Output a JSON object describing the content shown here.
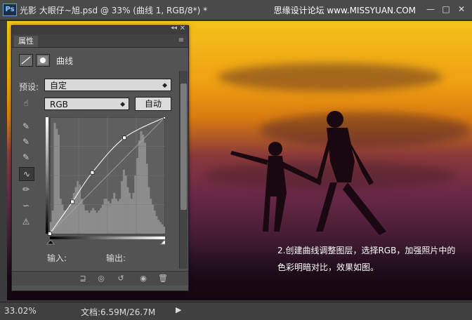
{
  "window": {
    "app_icon": "Ps",
    "title": "光影   大眼仔~旭.psd @ 33% (曲线 1, RGB/8*) *",
    "watermark": "思缘设计论坛 www.MISSYUAN.COM",
    "minimize": "—",
    "maximize": "□",
    "close": "✕"
  },
  "panel": {
    "tab_label": "属性",
    "header_title": "曲线",
    "preset_label": "预设:",
    "preset_value": "自定",
    "channel_value": "RGB",
    "auto_button": "自动",
    "input_label": "输入:",
    "output_label": "输出:"
  },
  "tools": [
    "eyedropper-black-icon",
    "eyedropper-gray-icon",
    "eyedropper-white-icon",
    "curve-point-icon",
    "pencil-icon",
    "smooth-icon",
    "clipping-warning-icon"
  ],
  "chart_data": {
    "type": "line",
    "title": "",
    "xlabel": "输入:",
    "ylabel": "输出:",
    "xlim": [
      0,
      255
    ],
    "ylim": [
      0,
      255
    ],
    "series": [
      {
        "values": [
          [
            0,
            0
          ],
          [
            50,
            70
          ],
          [
            94,
            134
          ],
          [
            165,
            210
          ],
          [
            255,
            255
          ]
        ]
      },
      {
        "values": [
          [
            0,
            0
          ],
          [
            255,
            255
          ]
        ]
      }
    ],
    "histogram": [
      0.1,
      0.2,
      0.95,
      0.9,
      0.85,
      0.3,
      0.25,
      0.2,
      0.2,
      0.22,
      0.25,
      0.3,
      0.35,
      0.4,
      0.45,
      0.42,
      0.3,
      0.25,
      0.2,
      0.2,
      0.18,
      0.2,
      0.22,
      0.2,
      0.18,
      0.2,
      0.22,
      0.25,
      0.3,
      0.3,
      0.28,
      0.26,
      0.3,
      0.35,
      0.3,
      0.28,
      0.3,
      0.45,
      0.55,
      0.5,
      0.4,
      0.35,
      0.3,
      0.35,
      0.5,
      0.65,
      0.8,
      0.88,
      0.85,
      0.78,
      0.6,
      0.4,
      0.3,
      0.25,
      0.2,
      0.15,
      0.12,
      0.1,
      0.08,
      0.06
    ]
  },
  "canvas_caption": "2.创建曲线调整图层，选择RGB，加强照片中的色彩明暗对比，效果如图。",
  "status": {
    "zoom": "33.02%",
    "doc": "文档:6.59M/26.7M",
    "play": "▶"
  }
}
